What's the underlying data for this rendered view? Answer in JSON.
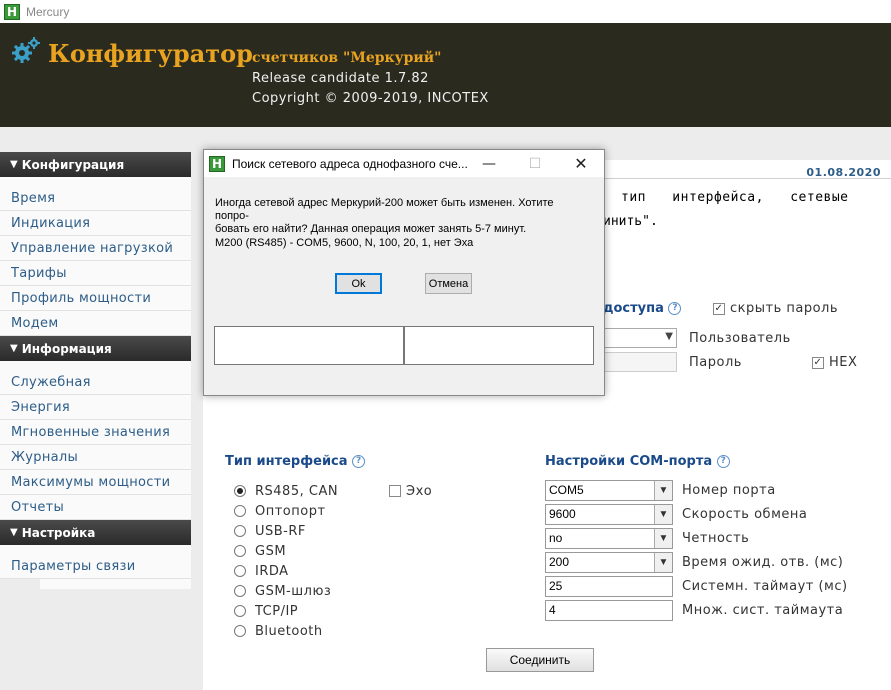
{
  "window": {
    "title": "Mercury"
  },
  "header": {
    "brand": "Конфигуратор",
    "subtitle": "счетчиков \"Меркурий\"",
    "release": "Release candidate 1.7.82",
    "copyright": "Copyright © 2009-2019, INCOTEX"
  },
  "sidebar": {
    "sections": [
      {
        "title": "Конфигурация",
        "items": [
          "Время",
          "Индикация",
          "Управление нагрузкой",
          "Тарифы",
          "Профиль мощности",
          "Модем"
        ]
      },
      {
        "title": "Информация",
        "items": [
          "Служебная",
          "Энергия",
          "Мгновенные значения",
          "Журналы",
          "Максимумы мощности",
          "Отчеты"
        ]
      },
      {
        "title": "Настройка",
        "items": [
          "Параметры связи"
        ]
      }
    ]
  },
  "main": {
    "date": "01.08.2020",
    "intro_line1": "тип интерфейса, сетевые",
    "intro_line2": "инить\".",
    "access": {
      "title": "доступа",
      "hide_password": "скрыть пароль",
      "hide_password_checked": true,
      "user_label": "Пользователь",
      "password_label": "Пароль",
      "hex_label": "HEX",
      "hex_checked": true
    },
    "interface": {
      "title": "Тип интерфейса",
      "options": [
        "RS485, CAN",
        "Оптопорт",
        "USB-RF",
        "GSM",
        "IRDA",
        "GSM-шлюз",
        "TCP/IP",
        "Bluetooth"
      ],
      "selected": "RS485, CAN",
      "echo_label": "Эхо"
    },
    "com": {
      "title": "Настройки COM-порта",
      "rows": [
        {
          "value": "COM5",
          "label": "Номер порта",
          "dropdown": true
        },
        {
          "value": "9600",
          "label": "Скорость обмена",
          "dropdown": true
        },
        {
          "value": "no",
          "label": "Четность",
          "dropdown": true
        },
        {
          "value": "200",
          "label": "Время ожид. отв. (мс)",
          "dropdown": true
        },
        {
          "value": "25",
          "label": "Системн. таймаут (мс)",
          "dropdown": false
        },
        {
          "value": "4",
          "label": "Множ. сист. таймаута",
          "dropdown": false
        }
      ]
    },
    "connect_button": "Соединить"
  },
  "dialog": {
    "title": "Поиск сетевого адреса однофазного сче...",
    "message": "Иногда сетевой адрес Меркурий-200 может быть изменен. Хотите попро-бовать его найти? Данная операция может занять 5-7 минут.",
    "message_line1": "Иногда сетевой адрес Меркурий-200 может быть изменен. Хотите попро-",
    "message_line2": "бовать его найти? Данная операция может занять 5-7 минут.",
    "info": "M200 (RS485) - COM5, 9600, N, 100, 20, 1, нет Эха",
    "ok_button": "Ok",
    "cancel_button": "Отмена"
  }
}
